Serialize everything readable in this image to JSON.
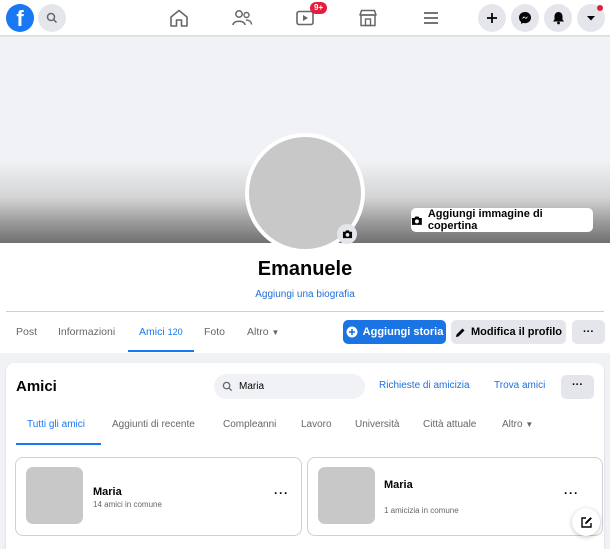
{
  "nav": {
    "notifications_badge": "9+",
    "icons": [
      "home-icon",
      "friends-icon",
      "watch-icon",
      "marketplace-icon",
      "menu-icon",
      "plus-icon",
      "messenger-icon",
      "notifications-icon",
      "account-caret-icon"
    ]
  },
  "cover": {
    "add_cover_label": "Aggiungi immagine di copertina"
  },
  "profile": {
    "name": "Emanuele",
    "bio_link": "Aggiungi una biografia"
  },
  "tabs": [
    {
      "label": "Post"
    },
    {
      "label": "Informazioni"
    },
    {
      "label": "Amici",
      "count": "120"
    },
    {
      "label": "Foto"
    },
    {
      "label": "Altro"
    }
  ],
  "actions": {
    "add_story": "Aggiungi storia",
    "edit_profile": "Modifica il profilo",
    "more": "···"
  },
  "friends": {
    "title": "Amici",
    "search_value": "Maria",
    "requests_link": "Richieste di amicizia",
    "find_link": "Trova amici",
    "more": "···",
    "subtabs": [
      {
        "label": "Tutti gli amici"
      },
      {
        "label": "Aggiunti di recente"
      },
      {
        "label": "Compleanni"
      },
      {
        "label": "Lavoro"
      },
      {
        "label": "Università"
      },
      {
        "label": "Città attuale"
      },
      {
        "label": "Altro"
      }
    ],
    "list": [
      {
        "name": "Maria",
        "mutual": "14 amici in comune"
      },
      {
        "name": "Maria",
        "mutual": "1 amicizia in comune"
      }
    ],
    "card_more": "···"
  },
  "colors": {
    "brand": "#1877f2",
    "badge": "#e41e3f"
  }
}
